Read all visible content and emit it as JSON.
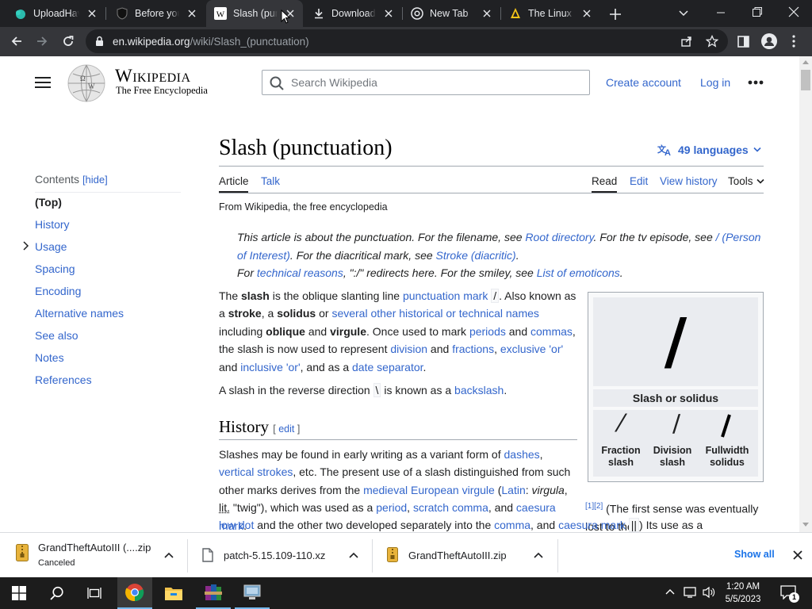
{
  "browser": {
    "tabs": [
      {
        "title": "UploadHaven",
        "active": false
      },
      {
        "title": "Before you",
        "active": false
      },
      {
        "title": "Slash (punctuation)",
        "active": true
      },
      {
        "title": "Downloads",
        "active": false
      },
      {
        "title": "New Tab",
        "active": false
      },
      {
        "title": "The Linux Kernel",
        "active": false
      }
    ],
    "url_host": "en.wikipedia.org",
    "url_path": "/wiki/Slash_(punctuation)"
  },
  "wiki": {
    "wordmark": "Wikipedia",
    "tagline": "The Free Encyclopedia",
    "search_placeholder": "Search Wikipedia",
    "create_account": "Create account",
    "log_in": "Log in",
    "toc": {
      "heading": "Contents",
      "hide": "[hide]",
      "items": [
        "(Top)",
        "History",
        "Usage",
        "Spacing",
        "Encoding",
        "Alternative names",
        "See also",
        "Notes",
        "References"
      ]
    },
    "title": "Slash (punctuation)",
    "languages": "49 languages",
    "tabs": {
      "article": "Article",
      "talk": "Talk",
      "read": "Read",
      "edit": "Edit",
      "view_history": "View history",
      "tools": "Tools"
    },
    "from": "From Wikipedia, the free encyclopedia",
    "hatnote": {
      "l1_a": "This article is about the punctuation. For the filename, see ",
      "l1_link": "Root directory",
      "l1_b": ". For the tv episode, see ",
      "l1_link2": "/ (Person of Interest)",
      "l1_c": ". For the diacritical mark, see ",
      "l1_link3": "Stroke (diacritic)",
      "l1_d": ".",
      "l2_a": "For ",
      "l2_link": "technical reasons",
      "l2_b": ", \":/\" redirects here. For the smiley, see ",
      "l2_link2": "List of emoticons",
      "l2_c": "."
    },
    "p1": {
      "t1": "The ",
      "b1": "slash",
      "t2": " is the oblique slanting line ",
      "a1": "punctuation mark",
      "code1": "/",
      "t3": ". Also known as a ",
      "b2": "stroke",
      "t4": ", a ",
      "b3": "solidus",
      "t5": " or ",
      "a2": "several other historical or technical names",
      "t6": " including ",
      "b4": "oblique",
      "t7": " and ",
      "b5": "virgule",
      "t8": ". Once used to mark ",
      "a3": "periods",
      "t9": " and ",
      "a4": "commas",
      "t10": ", the slash is now used to represent ",
      "a5": "division",
      "t11": " and ",
      "a6": "fractions",
      "t12": ", ",
      "a7": "exclusive 'or'",
      "t13": " and ",
      "a8": "inclusive 'or'",
      "t14": ", and as a ",
      "a9": "date separator",
      "t15": "."
    },
    "p2": {
      "t1": "A slash in the reverse direction ",
      "code": "\\",
      "t2": " is known as a ",
      "a1": "backslash",
      "t3": "."
    },
    "history": {
      "heading": "History",
      "edit": "edit",
      "t1": "Slashes may be found in early writing as a variant form of ",
      "a1": "dashes",
      "t2": ", ",
      "a2": "vertical strokes",
      "t3": ", etc. The present use of a slash distinguished from such other marks derives from the ",
      "a3": "medieval European virgule",
      "t4": " (",
      "a4": "Latin",
      "t5": ": ",
      "i1": "virgula",
      "t6": ", ",
      "abbr": "lit.",
      "t7": " \"twig\"), which was used as a ",
      "a5": "period",
      "t8": ", ",
      "a6": "scratch comma",
      "t9": ", and ",
      "a7": "caesura mark",
      "t10": ".",
      "sup": "[1][2]",
      "t11": " (The first sense was eventually lost to the ",
      "a8": "low dot",
      "t12": " and the other two developed separately into the ",
      "a9": "comma",
      "t13": ", and ",
      "a10": "caesura mark",
      "code2": "||",
      "t14": ") Its use as a"
    },
    "infobox": {
      "glyph": "/",
      "caption": "Slash or solidus",
      "variants": [
        {
          "glyph": "⁄",
          "label": "Fraction slash"
        },
        {
          "glyph": "∕",
          "label": "Division slash"
        },
        {
          "glyph": "／",
          "label": "Fullwidth solidus"
        }
      ]
    }
  },
  "downloads": {
    "items": [
      {
        "name": "GrandTheftAutoIII (....zip",
        "status": "Canceled"
      },
      {
        "name": "patch-5.15.109-110.xz",
        "status": ""
      },
      {
        "name": "GrandTheftAutoIII.zip",
        "status": ""
      }
    ],
    "show_all": "Show all"
  },
  "taskbar": {
    "time": "1:20 AM",
    "date": "5/5/2023",
    "notifications": "1"
  },
  "colors": {
    "link": "#3366cc",
    "tabstrip": "#202124",
    "toolbar": "#35363a"
  }
}
